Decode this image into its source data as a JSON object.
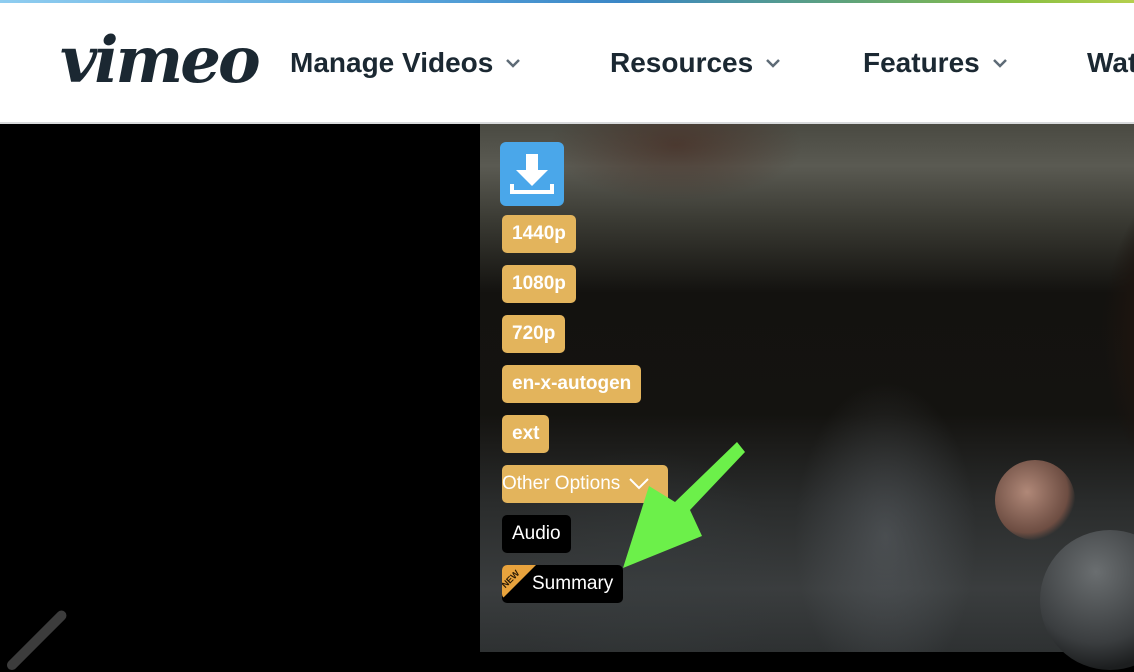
{
  "header": {
    "logo": "vimeo",
    "nav": [
      {
        "label": "Manage Videos",
        "has_dropdown": true
      },
      {
        "label": "Resources",
        "has_dropdown": true
      },
      {
        "label": "Features",
        "has_dropdown": true
      },
      {
        "label": "Wat",
        "has_dropdown": false
      }
    ]
  },
  "download_panel": {
    "icon": "download-icon",
    "options": [
      {
        "label": "1440p"
      },
      {
        "label": "1080p"
      },
      {
        "label": "720p"
      },
      {
        "label": "en-x-autogen"
      },
      {
        "label": "ext"
      }
    ],
    "other_options": "Other Options",
    "audio": "Audio",
    "summary": "Summary",
    "new_badge": "NEW"
  },
  "colors": {
    "accent_blue": "#4aa7ea",
    "option_gold": "#e3b45c",
    "badge_orange": "#e8a33d",
    "arrow_green": "#6cf04a",
    "nav_text": "#1b2832"
  }
}
